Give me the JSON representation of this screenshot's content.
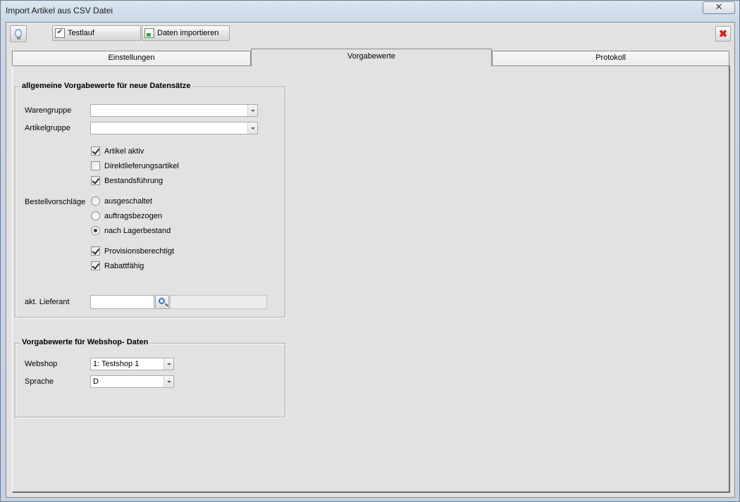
{
  "window": {
    "title": "Import Artikel aus CSV Datei",
    "close_glyph": "✕"
  },
  "toolbar": {
    "hint_icon": "lightbulb-icon",
    "testlauf_label": "Testlauf",
    "import_label": "Daten importieren",
    "exit_glyph": "✖"
  },
  "tabs": [
    {
      "label": "Einstellungen",
      "active": false
    },
    {
      "label": "Vorgabewerte",
      "active": true
    },
    {
      "label": "Protokoll",
      "active": false
    }
  ],
  "general_group": {
    "title": "allgemeine Vorgabewerte für neue Datensätze",
    "warengruppe_label": "Warengruppe",
    "warengruppe_value": "",
    "artikelgruppe_label": "Artikelgruppe",
    "artikelgruppe_value": "",
    "checkboxes_a": [
      {
        "label": "Artikel aktiv",
        "checked": true
      },
      {
        "label": "Direktlieferungsartikel",
        "checked": false
      },
      {
        "label": "Bestandsführung",
        "checked": true
      }
    ],
    "bestell_label": "Bestellvorschläge",
    "radios": [
      {
        "label": "ausgeschaltet",
        "selected": false
      },
      {
        "label": "auftragsbezogen",
        "selected": false
      },
      {
        "label": "nach Lagerbestand",
        "selected": true
      }
    ],
    "checkboxes_b": [
      {
        "label": "Provisionsberechtigt",
        "checked": true
      },
      {
        "label": "Rabattfähig",
        "checked": true
      }
    ],
    "lieferant_label": "akt. Lieferant",
    "lieferant_value": "",
    "lieferant_name": ""
  },
  "webshop_group": {
    "title": "Vorgabewerte für Webshop- Daten",
    "webshop_label": "Webshop",
    "webshop_value": "1: Testshop 1",
    "sprache_label": "Sprache",
    "sprache_value": "D"
  }
}
